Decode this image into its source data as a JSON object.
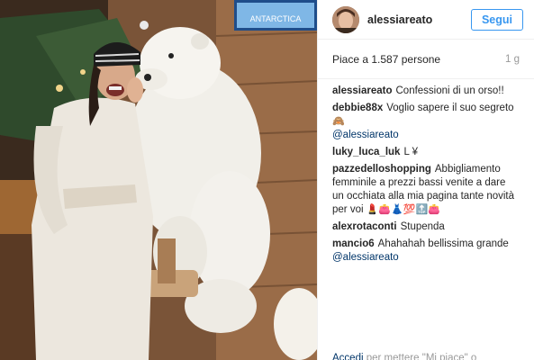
{
  "post": {
    "owner_username": "alessiareato",
    "follow_label": "Segui",
    "likes_text": "Piace a 1.587 persone",
    "time_ago": "1 g",
    "photo_sign_text": "ANTARCTICA"
  },
  "comments": [
    {
      "user": "alessiareato",
      "text": "Confessioni di un orso!!",
      "mention": "",
      "emoji": ""
    },
    {
      "user": "debbie88x",
      "text": "Voglio sapere il suo segreto",
      "emoji": "🙈",
      "mention": "@alessiareato"
    },
    {
      "user": "luky_luca_luk",
      "text": "L ¥",
      "mention": "",
      "emoji": ""
    },
    {
      "user": "pazzedelloshopping",
      "text": "Abbigliamento femminile a prezzi bassi venite a dare un occhiata alla mia pagina tante novità per voi",
      "emoji": "💄👛👗💯🔝👛",
      "mention": ""
    },
    {
      "user": "alexrotaconti",
      "text": "Stupenda",
      "mention": "",
      "emoji": ""
    },
    {
      "user": "mancio6",
      "text": "Ahahahah bellissima grande",
      "mention": "@alessiareato",
      "emoji": ""
    }
  ],
  "footer": {
    "login_link": "Accedi",
    "text": "per mettere \"Mi piace\" o"
  }
}
